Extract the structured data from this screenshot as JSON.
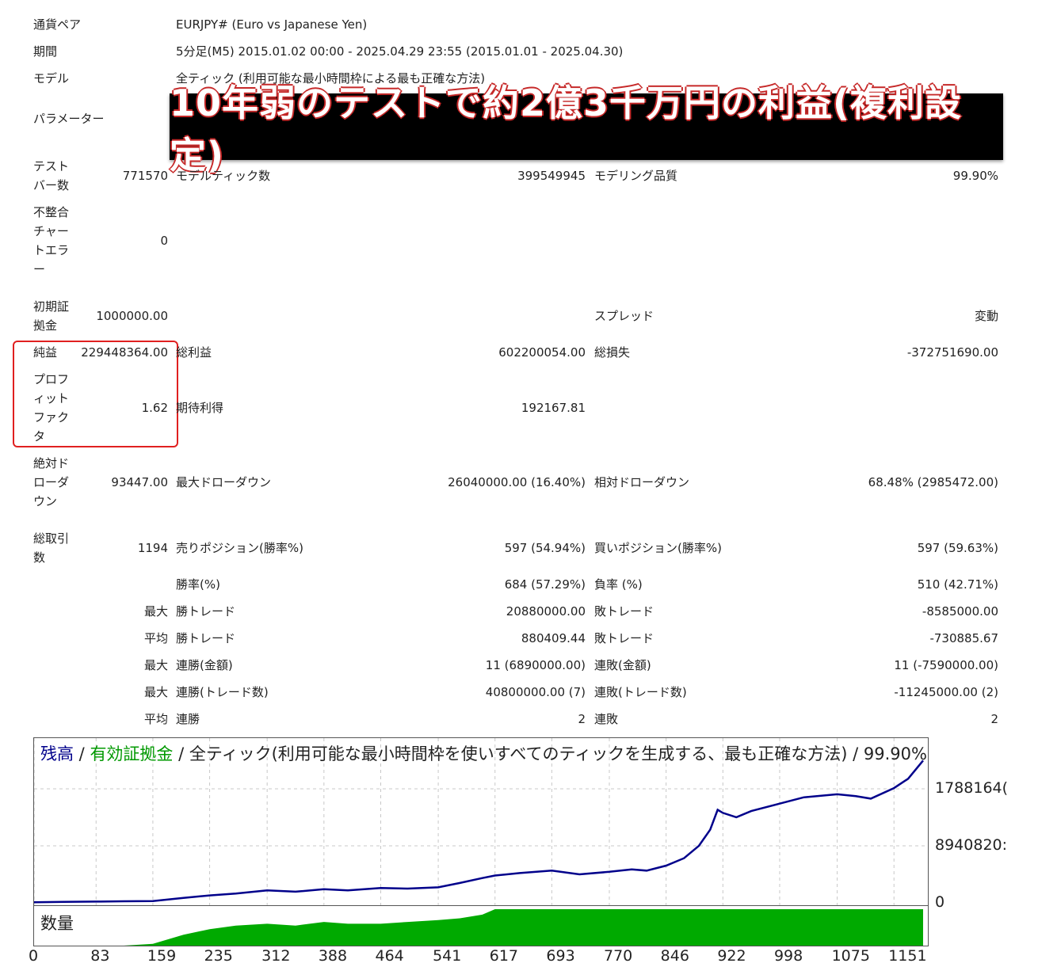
{
  "header": [
    {
      "label": "通貨ペア",
      "value": "EURJPY# (Euro vs Japanese Yen)"
    },
    {
      "label": "期間",
      "value": "5分足(M5) 2015.01.02 00:00 - 2025.04.29 23:55 (2015.01.01 - 2025.04.30)"
    },
    {
      "label": "モデル",
      "value": "全ティック (利用可能な最小時間枠による最も正確な方法)"
    },
    {
      "label": "パラメーター",
      "value": ""
    }
  ],
  "banner": "10年弱のテストで約2億3千万円の利益(複利設定)",
  "stats": {
    "test_bars_label": "テスト\nバー数",
    "test_bars": "771570",
    "model_ticks_label": "モデルティック数",
    "model_ticks": "399549945",
    "modeling_quality_label": "モデリング品質",
    "modeling_quality": "99.90%",
    "mismatch_label": "不整合\nチャー\nトエラ\nー",
    "mismatch": "0",
    "initial_deposit_label": "初期証\n拠金",
    "initial_deposit": "1000000.00",
    "spread_label": "スプレッド",
    "spread": "変動",
    "net_profit_label": "純益",
    "net_profit": "229448364.00",
    "gross_profit_label": "総利益",
    "gross_profit": "602200054.00",
    "gross_loss_label": "総損失",
    "gross_loss": "-372751690.00",
    "profit_factor_label": "プロフ\nィット\nファク\nタ",
    "profit_factor": "1.62",
    "expected_payoff_label": "期待利得",
    "expected_payoff": "192167.81",
    "abs_dd_label": "絶対ド\nローダ\nウン",
    "abs_dd": "93447.00",
    "max_dd_label": "最大ドローダウン",
    "max_dd": "26040000.00 (16.40%)",
    "rel_dd_label": "相対ドローダウン",
    "rel_dd": "68.48% (2985472.00)",
    "total_trades_label": "総取引\n数",
    "total_trades": "1194",
    "short_label": "売りポジション(勝率%)",
    "short": "597 (54.94%)",
    "long_label": "買いポジション(勝率%)",
    "long": "597 (59.63%)"
  },
  "rows": [
    {
      "prefix": "",
      "l1": "勝率(%)",
      "v1": "684 (57.29%)",
      "l2": "負率 (%)",
      "v2": "510 (42.71%)"
    },
    {
      "prefix": "最大",
      "l1": "勝トレード",
      "v1": "20880000.00",
      "l2": "敗トレード",
      "v2": "-8585000.00"
    },
    {
      "prefix": "平均",
      "l1": "勝トレード",
      "v1": "880409.44",
      "l2": "敗トレード",
      "v2": "-730885.67"
    },
    {
      "prefix": "最大",
      "l1": "連勝(金額)",
      "v1": "11 (6890000.00)",
      "l2": "連敗(金額)",
      "v2": "11 (-7590000.00)"
    },
    {
      "prefix": "最大",
      "l1": "連勝(トレード数)",
      "v1": "40800000.00 (7)",
      "l2": "連敗(トレード数)",
      "v2": "-11245000.00 (2)"
    },
    {
      "prefix": "平均",
      "l1": "連勝",
      "v1": "2",
      "l2": "連敗",
      "v2": "2"
    }
  ],
  "chart_title": {
    "balance": "残高",
    "sep1": " / ",
    "equity": "有効証拠金",
    "rest": " / 全ティック(利用可能な最小時間枠を使いすべてのティックを生成する、最も正確な方法) / 99.90%"
  },
  "volume_label": "数量",
  "colors": {
    "balance": "#00008b",
    "equity": "#009900",
    "volume": "#00aa00",
    "grid": "#c8c8c8"
  },
  "chart_data": {
    "type": "line",
    "x": [
      0,
      40,
      83,
      120,
      159,
      200,
      235,
      270,
      312,
      350,
      388,
      420,
      464,
      500,
      541,
      570,
      600,
      617,
      650,
      693,
      730,
      770,
      800,
      820,
      846,
      870,
      890,
      905,
      915,
      922,
      940,
      960,
      998,
      1030,
      1075,
      1100,
      1120,
      1151,
      1170,
      1190
    ],
    "series": [
      {
        "name": "残高",
        "values": [
          1000000,
          1500000,
          2000000,
          2500000,
          3000000,
          8000000,
          12000000,
          15000000,
          20000000,
          18000000,
          22000000,
          20000000,
          24000000,
          23000000,
          25000000,
          32000000,
          40000000,
          44000000,
          48000000,
          52000000,
          46000000,
          50000000,
          54000000,
          52000000,
          60000000,
          72000000,
          92000000,
          118000000,
          150000000,
          145000000,
          138000000,
          148000000,
          160000000,
          170000000,
          175000000,
          172000000,
          168000000,
          185000000,
          200000000,
          229448364
        ]
      }
    ],
    "y_ticks": [
      "1788164(",
      "8940820:",
      "0"
    ],
    "x_ticks": [
      "0",
      "83",
      "159",
      "235",
      "312",
      "388",
      "464",
      "541",
      "617",
      "693",
      "770",
      "846",
      "922",
      "998",
      "1075",
      "1151"
    ],
    "ylim": [
      0,
      240000000
    ],
    "volume_levels": [
      0,
      0,
      0,
      0,
      0.05,
      0.3,
      0.45,
      0.55,
      0.6,
      0.55,
      0.65,
      0.6,
      0.6,
      0.65,
      0.7,
      0.75,
      0.85,
      1,
      1,
      1,
      1,
      1,
      1,
      1,
      1,
      1,
      1,
      1,
      1,
      1,
      1,
      1,
      1,
      1,
      1,
      1,
      1,
      1,
      1,
      1
    ],
    "grid": true
  }
}
